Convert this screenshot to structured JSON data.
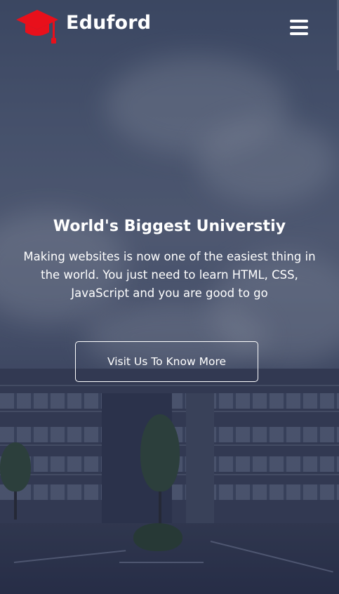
{
  "header": {
    "brand": "Eduford",
    "logo_icon": "graduation-cap-icon",
    "logo_color": "#e8101b",
    "menu_icon": "hamburger-menu-icon"
  },
  "hero": {
    "title": "World's Biggest Universtiy",
    "description": "Making websites is now one of the easiest thing in the world. You just need to learn HTML, CSS, JavaScript and you are good to go",
    "cta_label": "Visit Us To Know More"
  }
}
